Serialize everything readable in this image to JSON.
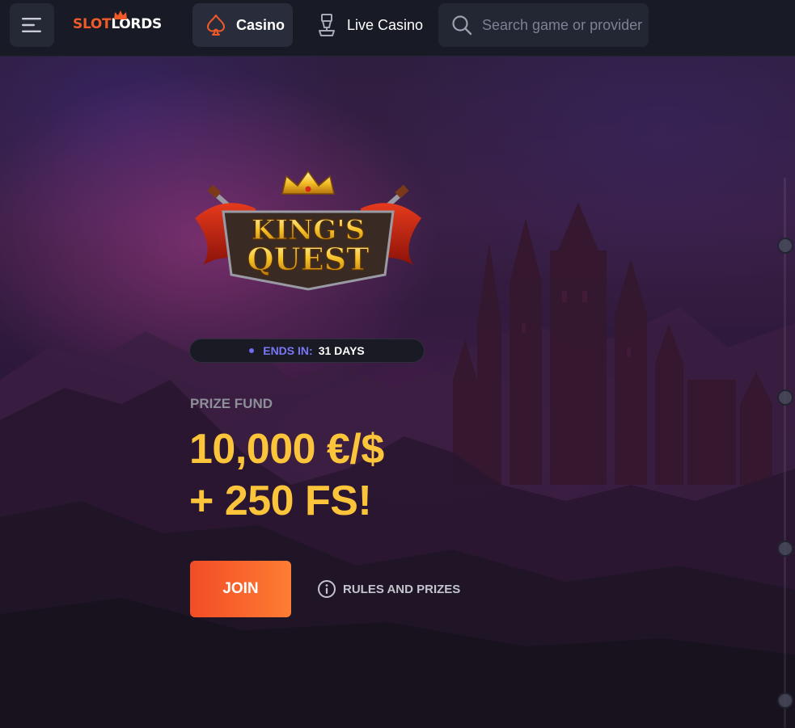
{
  "brand": {
    "logo_text_left": "SLOT",
    "logo_text_right": "LORDS",
    "accent_color": "#f05a28"
  },
  "header": {
    "menu_icon": "hamburger-icon",
    "nav": [
      {
        "label": "Casino",
        "icon": "spade-icon",
        "active": true
      },
      {
        "label": "Live Casino",
        "icon": "dealer-icon",
        "active": false
      }
    ],
    "search": {
      "placeholder": "Search game or provider",
      "value": "",
      "icon": "search-icon"
    }
  },
  "tournament": {
    "logo_text": "KING'S QUEST",
    "ends_label": "ENDS IN:",
    "ends_value": "31 DAYS",
    "prize_label": "PRIZE FUND",
    "prize_line_1": "10,000 €/$",
    "prize_line_2": "+ 250 FS!",
    "join_label": "JOIN",
    "rules_label": "RULES AND PRIZES",
    "prize_color": "#fcc43a",
    "ends_color": "#7a77f4"
  }
}
